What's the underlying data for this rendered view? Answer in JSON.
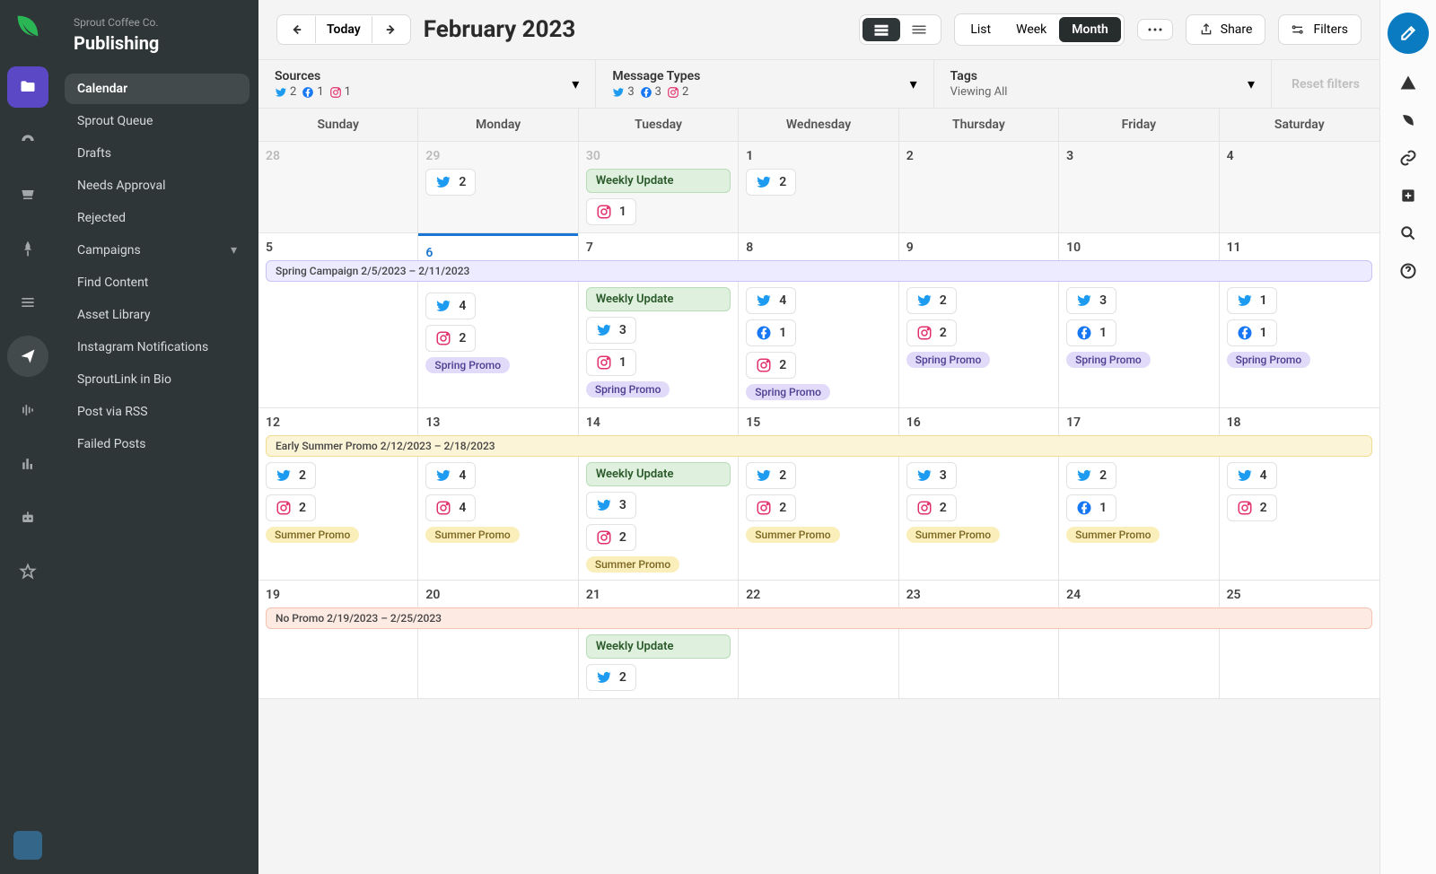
{
  "company": "Sprout Coffee Co.",
  "section": "Publishing",
  "nav": [
    "Calendar",
    "Sprout Queue",
    "Drafts",
    "Needs Approval",
    "Rejected",
    "Campaigns",
    "Find Content",
    "Asset Library",
    "Instagram Notifications",
    "SproutLink in Bio",
    "Post via RSS",
    "Failed Posts"
  ],
  "activeNav": "Calendar",
  "toolbar": {
    "today": "Today",
    "title": "February 2023",
    "list": "List",
    "week": "Week",
    "month": "Month",
    "share": "Share",
    "filters": "Filters"
  },
  "filterbar": {
    "sources": {
      "label": "Sources",
      "tw": "2",
      "fb": "1",
      "ig": "1"
    },
    "types": {
      "label": "Message Types",
      "tw": "3",
      "fb": "3",
      "ig": "2"
    },
    "tags": {
      "label": "Tags",
      "sub": "Viewing All"
    },
    "reset": "Reset filters"
  },
  "days": [
    "Sunday",
    "Monday",
    "Tuesday",
    "Wednesday",
    "Thursday",
    "Friday",
    "Saturday"
  ],
  "campaigns": {
    "spring": "Spring Campaign 2/5/2023 – 2/11/2023",
    "summer": "Early Summer Promo 2/12/2023 – 2/18/2023",
    "nopromo": "No Promo 2/19/2023 – 2/25/2023"
  },
  "labels": {
    "weekly": "Weekly Update",
    "springPromo": "Spring Promo",
    "summerPromo": "Summer Promo"
  },
  "weeks": [
    {
      "classes": "past",
      "cells": [
        {
          "num": "28",
          "muted": true
        },
        {
          "num": "29",
          "muted": true,
          "chips": [
            {
              "net": "tw",
              "n": "2"
            }
          ]
        },
        {
          "num": "30",
          "muted": true,
          "green": true,
          "chips": [
            {
              "net": "ig",
              "n": "1"
            }
          ]
        },
        {
          "num": "1",
          "chips": [
            {
              "net": "tw",
              "n": "2"
            }
          ]
        },
        {
          "num": "2"
        },
        {
          "num": "3"
        },
        {
          "num": "4"
        }
      ]
    },
    {
      "classes": "current",
      "campaign": {
        "kind": "purple",
        "textKey": "campaigns.spring"
      },
      "cells": [
        {
          "num": "5"
        },
        {
          "num": "6",
          "today": true,
          "chips": [
            {
              "net": "tw",
              "n": "4"
            },
            {
              "net": "ig",
              "n": "2"
            }
          ],
          "tag": {
            "kind": "purple",
            "key": "labels.springPromo"
          }
        },
        {
          "num": "7",
          "green": true,
          "chips": [
            {
              "net": "tw",
              "n": "3"
            },
            {
              "net": "ig",
              "n": "1"
            }
          ],
          "tag": {
            "kind": "purple",
            "key": "labels.springPromo"
          }
        },
        {
          "num": "8",
          "chips": [
            {
              "net": "tw",
              "n": "4"
            },
            {
              "net": "fb",
              "n": "1"
            },
            {
              "net": "ig",
              "n": "2"
            }
          ],
          "tag": {
            "kind": "purple",
            "key": "labels.springPromo"
          }
        },
        {
          "num": "9",
          "chips": [
            {
              "net": "tw",
              "n": "2"
            },
            {
              "net": "ig",
              "n": "2"
            }
          ],
          "tag": {
            "kind": "purple",
            "key": "labels.springPromo"
          }
        },
        {
          "num": "10",
          "chips": [
            {
              "net": "tw",
              "n": "3"
            },
            {
              "net": "fb",
              "n": "1"
            }
          ],
          "tag": {
            "kind": "purple",
            "key": "labels.springPromo"
          }
        },
        {
          "num": "11",
          "chips": [
            {
              "net": "tw",
              "n": "1"
            },
            {
              "net": "fb",
              "n": "1"
            }
          ],
          "tag": {
            "kind": "purple",
            "key": "labels.springPromo"
          }
        }
      ]
    },
    {
      "classes": "current",
      "campaign": {
        "kind": "yellow",
        "textKey": "campaigns.summer"
      },
      "cells": [
        {
          "num": "12",
          "chips": [
            {
              "net": "tw",
              "n": "2"
            },
            {
              "net": "ig",
              "n": "2"
            }
          ],
          "tag": {
            "kind": "yellow",
            "key": "labels.summerPromo"
          }
        },
        {
          "num": "13",
          "chips": [
            {
              "net": "tw",
              "n": "4"
            },
            {
              "net": "ig",
              "n": "4"
            }
          ],
          "tag": {
            "kind": "yellow",
            "key": "labels.summerPromo"
          }
        },
        {
          "num": "14",
          "green": true,
          "chips": [
            {
              "net": "tw",
              "n": "3"
            },
            {
              "net": "ig",
              "n": "2"
            }
          ],
          "tag": {
            "kind": "yellow",
            "key": "labels.summerPromo"
          }
        },
        {
          "num": "15",
          "chips": [
            {
              "net": "tw",
              "n": "2"
            },
            {
              "net": "ig",
              "n": "2"
            }
          ],
          "tag": {
            "kind": "yellow",
            "key": "labels.summerPromo"
          }
        },
        {
          "num": "16",
          "chips": [
            {
              "net": "tw",
              "n": "3"
            },
            {
              "net": "ig",
              "n": "2"
            }
          ],
          "tag": {
            "kind": "yellow",
            "key": "labels.summerPromo"
          }
        },
        {
          "num": "17",
          "chips": [
            {
              "net": "tw",
              "n": "2"
            },
            {
              "net": "fb",
              "n": "1"
            }
          ],
          "tag": {
            "kind": "yellow",
            "key": "labels.summerPromo"
          }
        },
        {
          "num": "18",
          "chips": [
            {
              "net": "tw",
              "n": "4"
            },
            {
              "net": "ig",
              "n": "2"
            }
          ]
        }
      ]
    },
    {
      "classes": "current",
      "campaign": {
        "kind": "red",
        "textKey": "campaigns.nopromo"
      },
      "cells": [
        {
          "num": "19"
        },
        {
          "num": "20"
        },
        {
          "num": "21",
          "green": true,
          "chips": [
            {
              "net": "tw",
              "n": "2"
            }
          ]
        },
        {
          "num": "22"
        },
        {
          "num": "23"
        },
        {
          "num": "24"
        },
        {
          "num": "25"
        }
      ]
    }
  ]
}
